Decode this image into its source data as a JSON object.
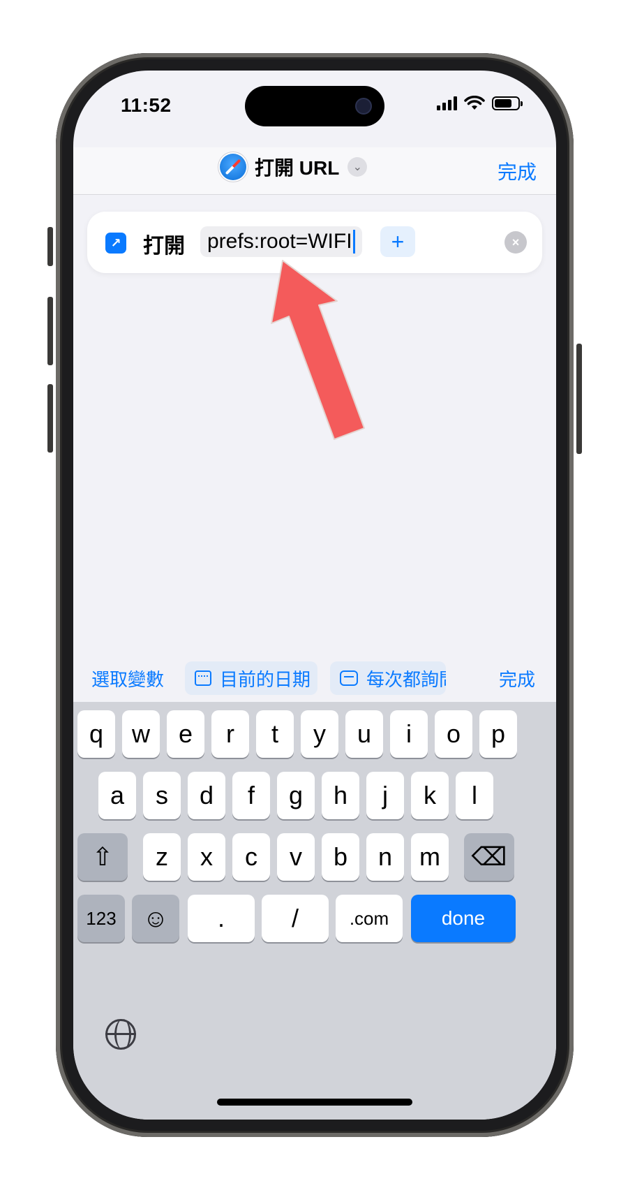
{
  "status_bar": {
    "time": "11:52"
  },
  "nav": {
    "title": "打開 URL",
    "done_label": "完成",
    "title_icon": "safari-icon",
    "chevron_icon": "chevron-down-icon"
  },
  "action": {
    "verb": "打開",
    "url_value": "prefs:root=WIFI",
    "plus_label": "+",
    "clear_label": "×",
    "icon": "open-url-icon"
  },
  "suggestions": {
    "variables_label": "選取變數",
    "current_date_label": "目前的日期",
    "ask_each_time_label": "每次都詢問",
    "done_label": "完成"
  },
  "keyboard": {
    "row1": [
      "q",
      "w",
      "e",
      "r",
      "t",
      "y",
      "u",
      "i",
      "o",
      "p"
    ],
    "row2": [
      "a",
      "s",
      "d",
      "f",
      "g",
      "h",
      "j",
      "k",
      "l"
    ],
    "row3": [
      "z",
      "x",
      "c",
      "v",
      "b",
      "n",
      "m"
    ],
    "shift_label": "⇧",
    "delete_label": "⌫",
    "numbers_label": "123",
    "emoji_label": "☺",
    "period_label": ".",
    "slash_label": "/",
    "dotcom_label": ".com",
    "done_label": "done"
  },
  "colors": {
    "accent": "#0a7aff",
    "annotation_arrow": "#f45b5b"
  }
}
